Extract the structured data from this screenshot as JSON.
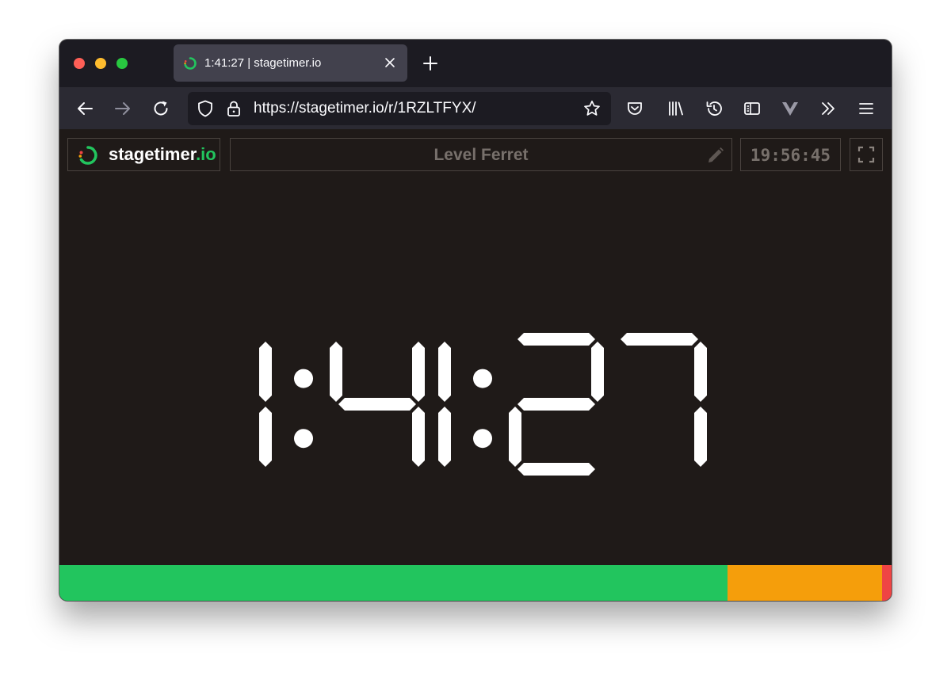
{
  "browser": {
    "tab": {
      "title": "1:41:27 | stagetimer.io"
    },
    "url": "https://stagetimer.io/r/1RZLTFYX/"
  },
  "app": {
    "logo": {
      "name": "stagetimer",
      "tld": ".io"
    },
    "timer_title": "Level Ferret",
    "clock": "19:56:45",
    "countdown": "1:41:27"
  },
  "progress": {
    "segments": [
      {
        "name": "green",
        "fraction": 0.803,
        "color": "#22c55e"
      },
      {
        "name": "yellow",
        "fraction": 0.186,
        "color": "#f59e0b"
      },
      {
        "name": "red",
        "fraction": 0.011,
        "color": "#ef4444"
      }
    ]
  },
  "icons": [
    "back-arrow-icon",
    "forward-arrow-icon",
    "reload-icon",
    "shield-icon",
    "lock-icon",
    "star-icon",
    "pocket-icon",
    "library-icon",
    "history-icon",
    "sidebar-icon",
    "vue-devtools-icon",
    "overflow-chevrons-icon",
    "hamburger-menu-icon",
    "pencil-icon",
    "fullscreen-icon"
  ]
}
